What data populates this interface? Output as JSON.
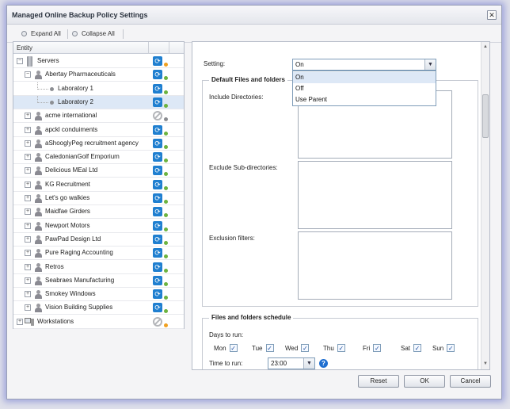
{
  "window": {
    "title": "Managed Online Backup Policy Settings",
    "close_glyph": "✕"
  },
  "toolbar": {
    "expand_all": "Expand All",
    "collapse_all": "Collapse All"
  },
  "tree": {
    "header": "Entity",
    "nodes": [
      {
        "label": "Servers",
        "type": "server",
        "status": "#f0a020"
      },
      {
        "label": "Abertay Pharmaceuticals",
        "type": "person",
        "status": "#6cb33f"
      },
      {
        "label": "Laboratory 1",
        "type": "leaf",
        "status": "#6cb33f"
      },
      {
        "label": "Laboratory 2",
        "type": "leaf",
        "status": "#6cb33f",
        "selected": true
      },
      {
        "label": "acme international",
        "type": "person",
        "status": "#8a8c90",
        "off": true
      },
      {
        "label": "apckl conduiments",
        "type": "person",
        "status": "#6cb33f"
      },
      {
        "label": "aShooglyPeg recruitment agency",
        "type": "person",
        "status": "#6cb33f"
      },
      {
        "label": "CaledonianGolf Emporium",
        "type": "person",
        "status": "#6cb33f"
      },
      {
        "label": "Delicious MEal Ltd",
        "type": "person",
        "status": "#6cb33f"
      },
      {
        "label": "KG Recruitment",
        "type": "person",
        "status": "#6cb33f"
      },
      {
        "label": "Let's go walkies",
        "type": "person",
        "status": "#6cb33f"
      },
      {
        "label": "Maidfae Girders",
        "type": "person",
        "status": "#6cb33f"
      },
      {
        "label": "Newport Motors",
        "type": "person",
        "status": "#6cb33f"
      },
      {
        "label": "PawPad Design Ltd",
        "type": "person",
        "status": "#6cb33f"
      },
      {
        "label": "Pure Raging Accounting",
        "type": "person",
        "status": "#6cb33f"
      },
      {
        "label": "Retros",
        "type": "person",
        "status": "#6cb33f"
      },
      {
        "label": "Seabraes Manufacturing",
        "type": "person",
        "status": "#6cb33f"
      },
      {
        "label": "Smokey Windows",
        "type": "person",
        "status": "#6cb33f"
      },
      {
        "label": "Vision Building Supplies",
        "type": "person",
        "status": "#6cb33f"
      },
      {
        "label": "Workstations",
        "type": "workstation",
        "status": "#f0a020",
        "off": true
      }
    ]
  },
  "settings": {
    "setting_label": "Setting:",
    "setting_value": "On",
    "options": [
      "On",
      "Off",
      "Use Parent"
    ],
    "files_section_title": "Default Files and folders",
    "include_label": "Include Directories:",
    "exclude_label": "Exclude Sub-directories:",
    "filters_label": "Exclusion filters:",
    "schedule_title": "Files and folders schedule",
    "days_label": "Days to run:",
    "days": [
      "Mon",
      "Tue",
      "Wed",
      "Thu",
      "Fri",
      "Sat",
      "Sun"
    ],
    "time_label": "Time to run:",
    "time_value": "23:00",
    "help_glyph": "?"
  },
  "buttons": {
    "reset": "Reset",
    "ok": "OK",
    "cancel": "Cancel"
  },
  "icons": {
    "sync": "sync-icon",
    "disabled": "disabled-icon",
    "checkbox_glyph": "✓",
    "expand_glyph": "+",
    "collapse_glyph": "−",
    "dropdown_glyph": "▼"
  }
}
